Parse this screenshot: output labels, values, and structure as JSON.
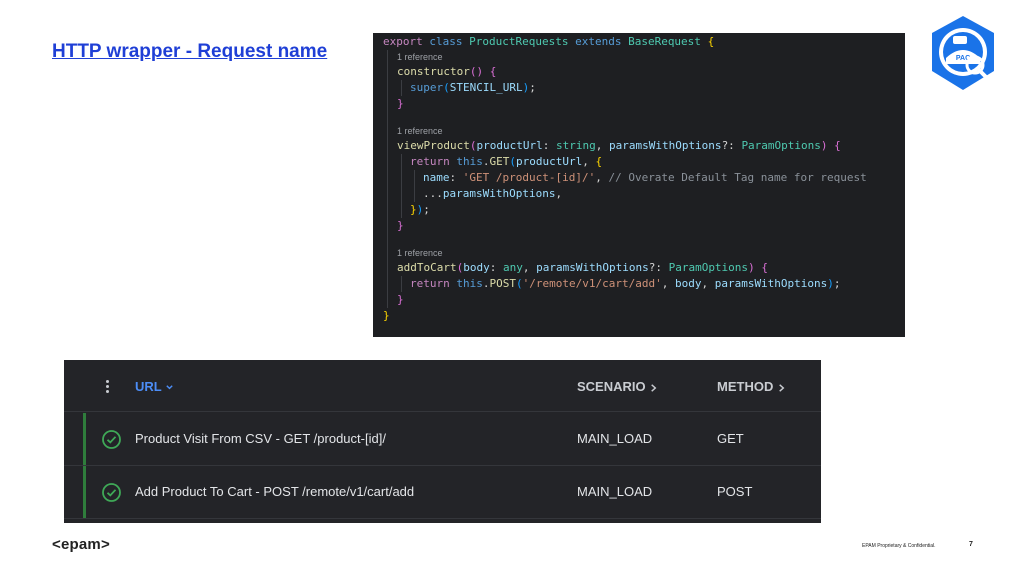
{
  "slide": {
    "title": "HTTP wrapper - Request name",
    "page_number": "7",
    "footer_logo": "<epam>",
    "footer_confidential": "EPAM Proprietary & Confidential."
  },
  "code": {
    "reference_label": "1 reference",
    "lines": [
      "export class ProductRequests extends BaseRequest {",
      "1 reference",
      "constructor() {",
      "super(STENCIL_URL);",
      "}",
      "",
      "1 reference",
      "viewProduct(productUrl: string, paramsWithOptions?: ParamOptions) {",
      "return this.GET(productUrl, {",
      "name: 'GET /product-[id]/', // Overate Default Tag name for request",
      "...paramsWithOptions,",
      "});",
      "}",
      "",
      "1 reference",
      "addToCart(body: any, paramsWithOptions?: ParamOptions) {",
      "return this.POST('/remote/v1/cart/add', body, paramsWithOptions);",
      "}",
      "}"
    ]
  },
  "table": {
    "columns": [
      "URL",
      "SCENARIO",
      "METHOD"
    ],
    "rows": [
      {
        "url": "Product Visit From CSV - GET /product-[id]/",
        "scenario": "MAIN_LOAD",
        "method": "GET",
        "status": "success"
      },
      {
        "url": "Add Product To Cart - POST /remote/v1/cart/add",
        "scenario": "MAIN_LOAD",
        "method": "POST",
        "status": "success"
      }
    ]
  },
  "icons": {
    "logo": "pac-shield-logo-icon",
    "row_status": "check-circle-icon",
    "menu": "kebab-menu-icon",
    "url_sort": "chevron-down-icon",
    "column_expand": "chevron-right-icon"
  },
  "colors": {
    "title": "#1f3fd6",
    "code_bg": "#1e1f22",
    "table_bg": "#232428",
    "success": "#3fa957",
    "accent_link": "#4c8df6",
    "logo": "#1a73e8"
  }
}
